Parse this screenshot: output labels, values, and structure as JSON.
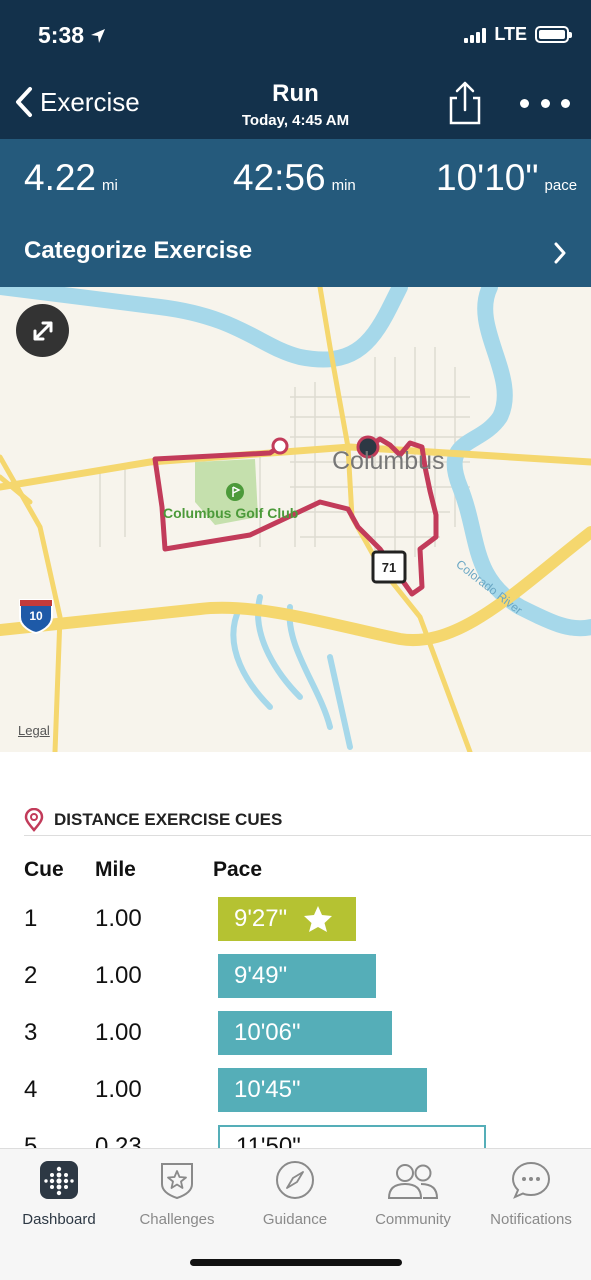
{
  "status_bar": {
    "time": "5:38",
    "network": "LTE"
  },
  "nav": {
    "back_label": "Exercise",
    "title": "Run",
    "subtitle": "Today, 4:45 AM"
  },
  "stats": {
    "distance": {
      "value": "4.22",
      "unit": "mi"
    },
    "duration": {
      "value": "42:56",
      "unit": "min"
    },
    "pace": {
      "value": "10'10\"",
      "unit": "pace"
    }
  },
  "categorize_label": "Categorize Exercise",
  "map": {
    "city_label": "Columbus",
    "golf_label": "Columbus Golf Club",
    "river_label": "Colorado River",
    "highway_shield": "10",
    "legal_label": "Legal",
    "route_color": "#c23b5a",
    "water_color": "#a6d8ea",
    "road_color": "#f5d76e"
  },
  "cues": {
    "header": "DISTANCE EXERCISE CUES",
    "columns": {
      "cue": "Cue",
      "mile": "Mile",
      "pace": "Pace"
    },
    "rows": [
      {
        "cue": "1",
        "mile": "1.00",
        "pace": "9'27\"",
        "best": true
      },
      {
        "cue": "2",
        "mile": "1.00",
        "pace": "9'49\"",
        "best": false
      },
      {
        "cue": "3",
        "mile": "1.00",
        "pace": "10'06\"",
        "best": false
      },
      {
        "cue": "4",
        "mile": "1.00",
        "pace": "10'45\"",
        "best": false
      },
      {
        "cue": "5",
        "mile": "0.23",
        "pace": "11'50\"",
        "best": false
      }
    ]
  },
  "tabs": [
    {
      "label": "Dashboard",
      "icon": "dashboard-icon",
      "active": true
    },
    {
      "label": "Challenges",
      "icon": "challenges-star-icon",
      "active": false
    },
    {
      "label": "Guidance",
      "icon": "compass-icon",
      "active": false
    },
    {
      "label": "Community",
      "icon": "people-icon",
      "active": false
    },
    {
      "label": "Notifications",
      "icon": "chat-bubble-icon",
      "active": false
    }
  ]
}
